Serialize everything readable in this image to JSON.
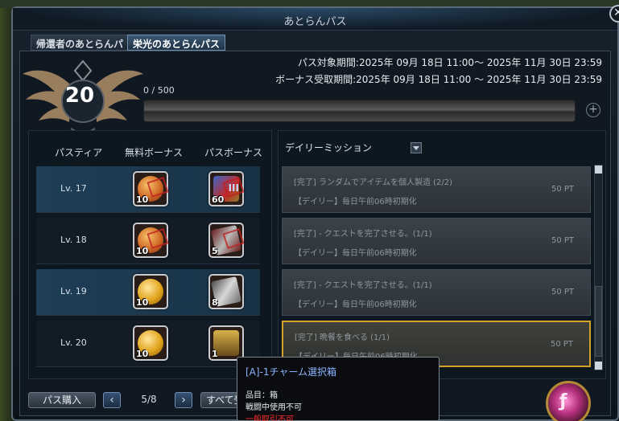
{
  "window": {
    "title": "あとらんパス",
    "close_icon": "close-icon"
  },
  "tabs": [
    {
      "label": "帰還者のあとらんパス",
      "active": false
    },
    {
      "label": "栄光のあとらんパス",
      "active": true
    }
  ],
  "header": {
    "level": "20",
    "progress": "0 / 500",
    "period": "パス対象期間:2025年 09月 18日 11:00～ 2025年 11月 30日 23:59",
    "bonus_period": "ボーナス受取期間:2025年 09月 18日 11:00 ～ 2025年 11月 30日 23:59"
  },
  "tiers": {
    "headers": {
      "tier": "パスティア",
      "free": "無料ボーナス",
      "pass": "パスボーナス"
    },
    "rows": [
      {
        "level": "Lv. 17",
        "free_count": "10",
        "pass_count": "60",
        "pass_badge": "III"
      },
      {
        "level": "Lv. 18",
        "free_count": "10",
        "pass_count": "5"
      },
      {
        "level": "Lv. 19",
        "free_count": "10",
        "pass_count": "8"
      },
      {
        "level": "Lv. 20",
        "free_count": "10",
        "pass_count": "1"
      }
    ]
  },
  "footer": {
    "buy_label": "パス購入",
    "page": "5/8",
    "receive_all_label": "すべて受"
  },
  "missions": {
    "title": "デイリーミッション",
    "items": [
      {
        "text": "[完了] ランダムでアイテムを個人製造 (2/2)",
        "sub": "【デイリー】毎日午前06時初期化",
        "pt": "50 PT"
      },
      {
        "text": "[完了] - クエストを完了させる。(1/1)",
        "sub": "【デイリー】毎日午前06時初期化",
        "pt": "50 PT"
      },
      {
        "text": "[完了] - クエストを完了させる。(1/1)",
        "sub": "【デイリー】毎日午前06時初期化",
        "pt": "50 PT"
      },
      {
        "text": "[完了] 晩餐を食べる (1/1)",
        "sub": "【デイリー】毎日午前06時初期化",
        "pt": "50 PT"
      }
    ]
  },
  "tooltip": {
    "title": "[A]-1チャーム選択箱",
    "line1": "品目：箱",
    "line2": "戦闘中使用不可",
    "line3": "一般取引不可"
  }
}
